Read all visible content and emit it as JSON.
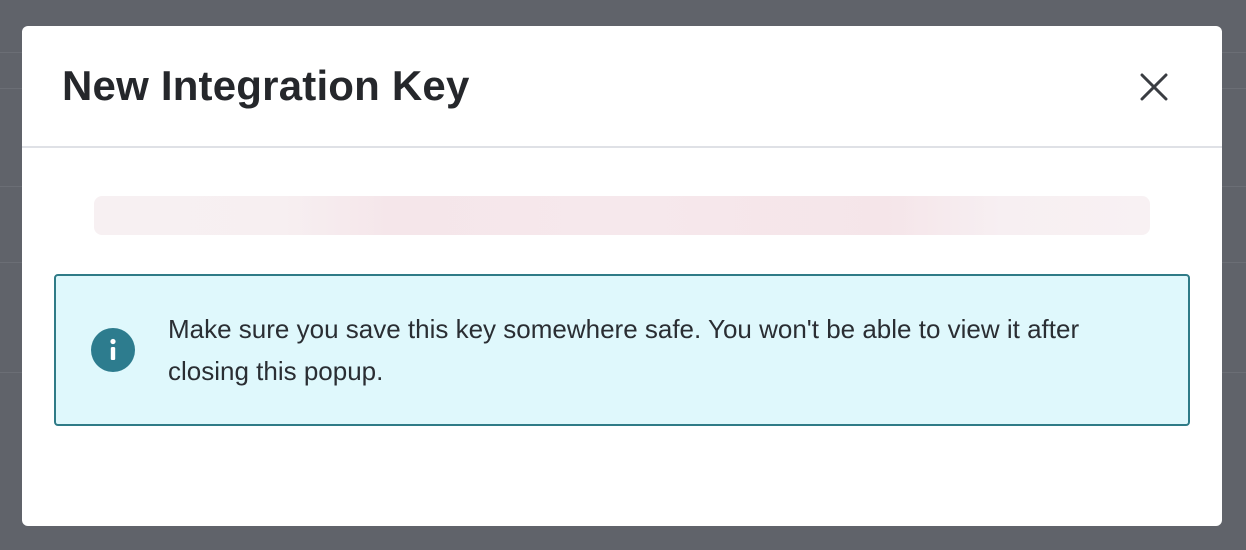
{
  "modal": {
    "title": "New Integration Key",
    "close_icon": "close-icon",
    "key_value": "",
    "alert": {
      "icon": "info-icon",
      "message": "Make sure you save this key somewhere safe. You won't be able to view it after closing this popup."
    }
  },
  "colors": {
    "overlay": "#60636a",
    "alert_background": "#dff8fc",
    "alert_border": "#2f7b87",
    "info_icon": "#2d7c8e",
    "title_text": "#25272b"
  }
}
